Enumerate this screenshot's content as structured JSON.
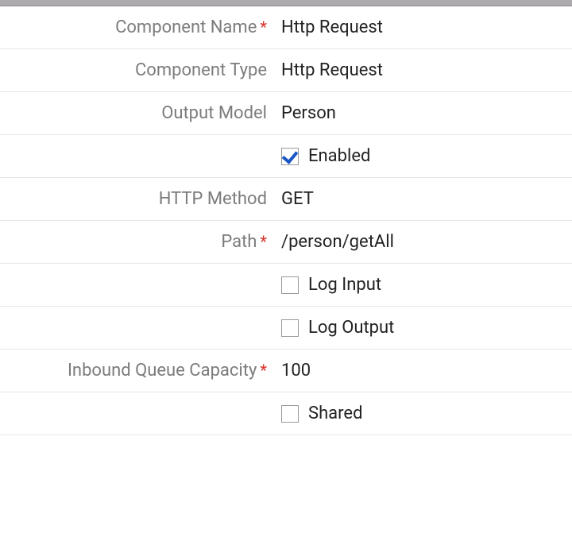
{
  "fields": {
    "componentName": {
      "label": "Component Name",
      "required": true,
      "value": "Http Request"
    },
    "componentType": {
      "label": "Component Type",
      "required": false,
      "value": "Http Request"
    },
    "outputModel": {
      "label": "Output Model",
      "required": false,
      "value": "Person"
    },
    "enabled": {
      "label": "Enabled",
      "checked": true
    },
    "httpMethod": {
      "label": "HTTP Method",
      "required": false,
      "value": "GET"
    },
    "path": {
      "label": "Path",
      "required": true,
      "value": "/person/getAll"
    },
    "logInput": {
      "label": "Log Input",
      "checked": false
    },
    "logOutput": {
      "label": "Log Output",
      "checked": false
    },
    "inboundQueueCapacity": {
      "label": "Inbound Queue Capacity",
      "required": true,
      "value": "100"
    },
    "shared": {
      "label": "Shared",
      "checked": false
    }
  }
}
